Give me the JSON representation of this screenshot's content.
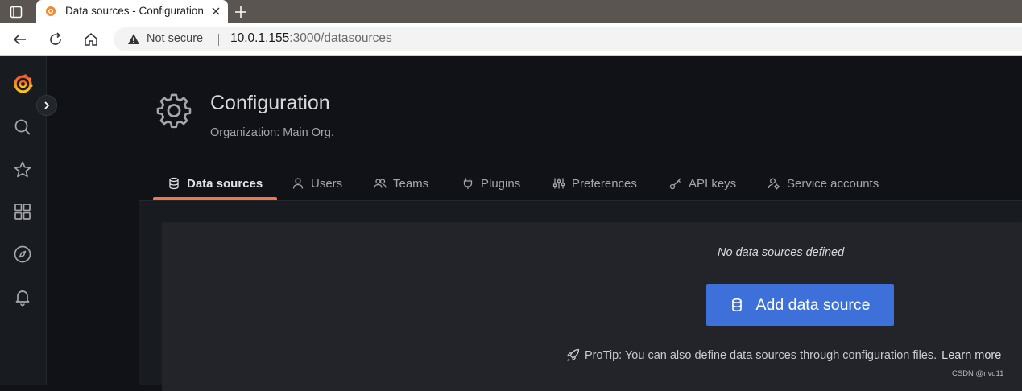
{
  "browser": {
    "tab_title": "Data sources - Configuration",
    "security_label": "Not secure",
    "url_host": "10.0.1.155",
    "url_path": ":3000/datasources"
  },
  "page": {
    "title": "Configuration",
    "subtitle": "Organization: Main Org."
  },
  "tabs": [
    {
      "label": "Data sources",
      "icon": "database-icon",
      "active": true
    },
    {
      "label": "Users",
      "icon": "user-icon"
    },
    {
      "label": "Teams",
      "icon": "users-icon"
    },
    {
      "label": "Plugins",
      "icon": "plug-icon"
    },
    {
      "label": "Preferences",
      "icon": "sliders-icon"
    },
    {
      "label": "API keys",
      "icon": "key-icon"
    },
    {
      "label": "Service accounts",
      "icon": "user-cog-icon"
    }
  ],
  "empty_state": {
    "title": "No data sources defined",
    "button_label": "Add data source",
    "protip_text": "ProTip: You can also define data sources through configuration files.",
    "learn_more": "Learn more"
  },
  "watermark": "CSDN @nvd11",
  "colors": {
    "accent": "#f1774a",
    "primary_button": "#3d71d9",
    "background": "#111217"
  }
}
